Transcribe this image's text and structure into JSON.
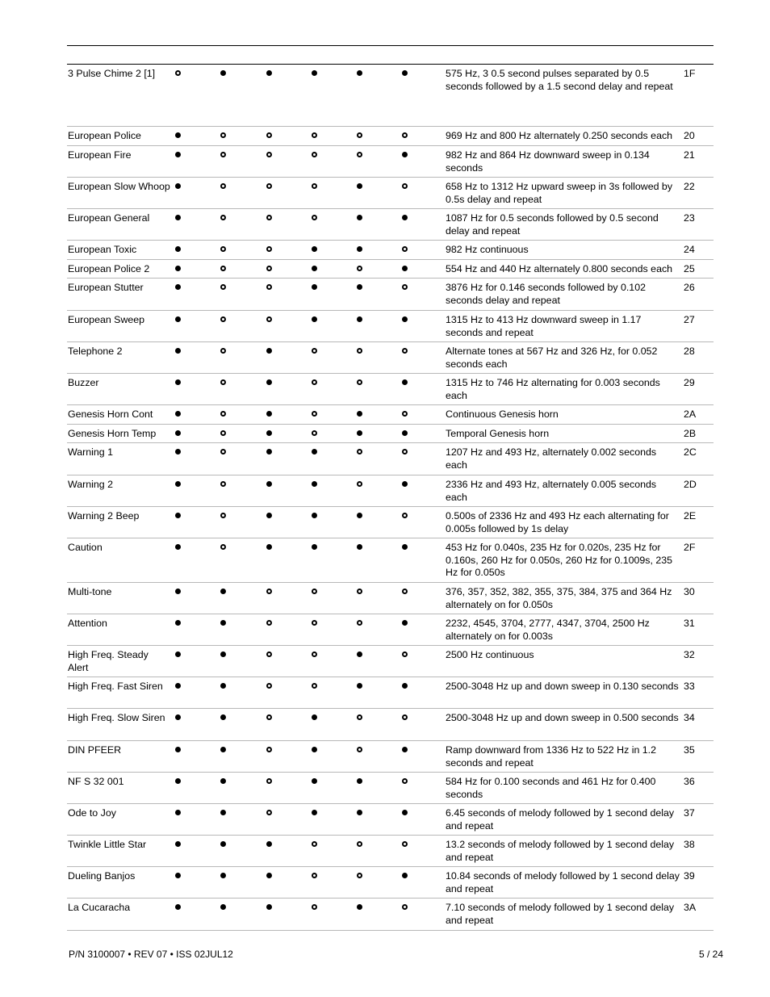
{
  "table": {
    "rows": [
      {
        "name": "3 Pulse Chime 2 [1]",
        "switches": [
          0,
          1,
          1,
          1,
          1,
          1
        ],
        "description": "575 Hz, 3 0.5 second pulses separated by 0.5 seconds followed by a 1.5 second delay and repeat",
        "code": "1F"
      },
      {
        "name": "European Police",
        "switches": [
          1,
          0,
          0,
          0,
          0,
          0
        ],
        "description": "969 Hz and 800 Hz alternately 0.250 seconds each",
        "code": "20"
      },
      {
        "name": "European Fire",
        "switches": [
          1,
          0,
          0,
          0,
          0,
          1
        ],
        "description": "982 Hz and 864 Hz downward sweep in 0.134 seconds",
        "code": "21"
      },
      {
        "name": "European Slow Whoop",
        "switches": [
          1,
          0,
          0,
          0,
          1,
          0
        ],
        "description": "658 Hz to 1312 Hz upward sweep in 3s followed by 0.5s delay and repeat",
        "code": "22"
      },
      {
        "name": "European General",
        "switches": [
          1,
          0,
          0,
          0,
          1,
          1
        ],
        "description": "1087 Hz for 0.5 seconds followed by 0.5 second delay and repeat",
        "code": "23"
      },
      {
        "name": "European Toxic",
        "switches": [
          1,
          0,
          0,
          1,
          1,
          0
        ],
        "description": "982 Hz continuous",
        "code": "24"
      },
      {
        "name": "European Police 2",
        "switches": [
          1,
          0,
          0,
          1,
          0,
          1
        ],
        "description": "554 Hz and 440 Hz alternately 0.800 seconds each",
        "code": "25"
      },
      {
        "name": "European Stutter",
        "switches": [
          1,
          0,
          0,
          1,
          1,
          0
        ],
        "description": "3876 Hz for 0.146 seconds followed by 0.102 seconds delay and repeat",
        "code": "26"
      },
      {
        "name": "European Sweep",
        "switches": [
          1,
          0,
          0,
          1,
          1,
          1
        ],
        "description": "1315 Hz to 413 Hz downward sweep in 1.17 seconds and repeat",
        "code": "27"
      },
      {
        "name": "Telephone 2",
        "switches": [
          1,
          0,
          1,
          0,
          0,
          0
        ],
        "description": "Alternate tones at 567 Hz and 326 Hz, for 0.052 seconds each",
        "code": "28"
      },
      {
        "name": "Buzzer",
        "switches": [
          1,
          0,
          1,
          0,
          0,
          1
        ],
        "description": "1315 Hz to 746 Hz alternating for 0.003 seconds each",
        "code": "29"
      },
      {
        "name": "Genesis Horn Cont",
        "switches": [
          1,
          0,
          1,
          0,
          1,
          0
        ],
        "description": "Continuous Genesis horn",
        "code": "2A"
      },
      {
        "name": "Genesis Horn Temp",
        "switches": [
          1,
          0,
          1,
          0,
          1,
          1
        ],
        "description": "Temporal Genesis horn",
        "code": "2B"
      },
      {
        "name": "Warning 1",
        "switches": [
          1,
          0,
          1,
          1,
          0,
          0
        ],
        "description": "1207 Hz and 493 Hz, alternately 0.002 seconds each",
        "code": "2C"
      },
      {
        "name": "Warning 2",
        "switches": [
          1,
          0,
          1,
          1,
          0,
          1
        ],
        "description": "2336 Hz and 493 Hz, alternately 0.005 seconds each",
        "code": "2D"
      },
      {
        "name": "Warning 2 Beep",
        "switches": [
          1,
          0,
          1,
          1,
          1,
          0
        ],
        "description": "0.500s of 2336 Hz and 493 Hz each alternating for 0.005s followed by 1s delay",
        "code": "2E"
      },
      {
        "name": "Caution",
        "switches": [
          1,
          0,
          1,
          1,
          1,
          1
        ],
        "description": "453 Hz for 0.040s, 235 Hz for 0.020s, 235 Hz for 0.160s, 260 Hz for 0.050s, 260 Hz for 0.1009s, 235 Hz for 0.050s",
        "code": "2F"
      },
      {
        "name": "Multi-tone",
        "switches": [
          1,
          1,
          0,
          0,
          0,
          0
        ],
        "description": "376, 357, 352, 382, 355, 375, 384, 375 and 364 Hz alternately on for 0.050s",
        "code": "30"
      },
      {
        "name": "Attention",
        "switches": [
          1,
          1,
          0,
          0,
          0,
          1
        ],
        "description": "2232, 4545, 3704, 2777, 4347, 3704, 2500 Hz alternately on for 0.003s",
        "code": "31"
      },
      {
        "name": "High Freq. Steady Alert",
        "switches": [
          1,
          1,
          0,
          0,
          1,
          0
        ],
        "description": "2500 Hz continuous",
        "code": "32"
      },
      {
        "name": "High Freq. Fast Siren",
        "switches": [
          1,
          1,
          0,
          0,
          1,
          1
        ],
        "description": "2500-3048 Hz up and down sweep in 0.130 seconds",
        "code": "33"
      },
      {
        "name": "High Freq. Slow Siren",
        "switches": [
          1,
          1,
          0,
          1,
          0,
          0
        ],
        "description": "2500-3048 Hz up and down sweep in 0.500 seconds",
        "code": "34"
      },
      {
        "name": "DIN PFEER",
        "switches": [
          1,
          1,
          0,
          1,
          0,
          1
        ],
        "description": "Ramp downward from 1336 Hz to 522 Hz in 1.2 seconds and repeat",
        "code": "35"
      },
      {
        "name": "NF S 32 001",
        "switches": [
          1,
          1,
          0,
          1,
          1,
          0
        ],
        "description": "584 Hz for 0.100 seconds and 461 Hz for 0.400 seconds",
        "code": "36"
      },
      {
        "name": "Ode to Joy",
        "switches": [
          1,
          1,
          0,
          1,
          1,
          1
        ],
        "description": "6.45 seconds of melody followed by 1 second delay and repeat",
        "code": "37"
      },
      {
        "name": "Twinkle Little Star",
        "switches": [
          1,
          1,
          1,
          0,
          0,
          0
        ],
        "description": "13.2 seconds of melody followed by 1 second delay and repeat",
        "code": "38"
      },
      {
        "name": "Dueling Banjos",
        "switches": [
          1,
          1,
          1,
          0,
          0,
          1
        ],
        "description": "10.84 seconds of melody followed by 1 second delay and repeat",
        "code": "39"
      },
      {
        "name": "La Cucaracha",
        "switches": [
          1,
          1,
          1,
          0,
          1,
          0
        ],
        "description": "7.10 seconds of melody followed by 1 second delay and repeat",
        "code": "3A"
      }
    ]
  },
  "legend": {
    "on_icon": "filled-circle",
    "off_icon": "hollow-circle"
  },
  "footer": {
    "doc_id": "P/N 3100007 • REV 07 • ISS 02JUL12",
    "page": "5 / 24"
  }
}
